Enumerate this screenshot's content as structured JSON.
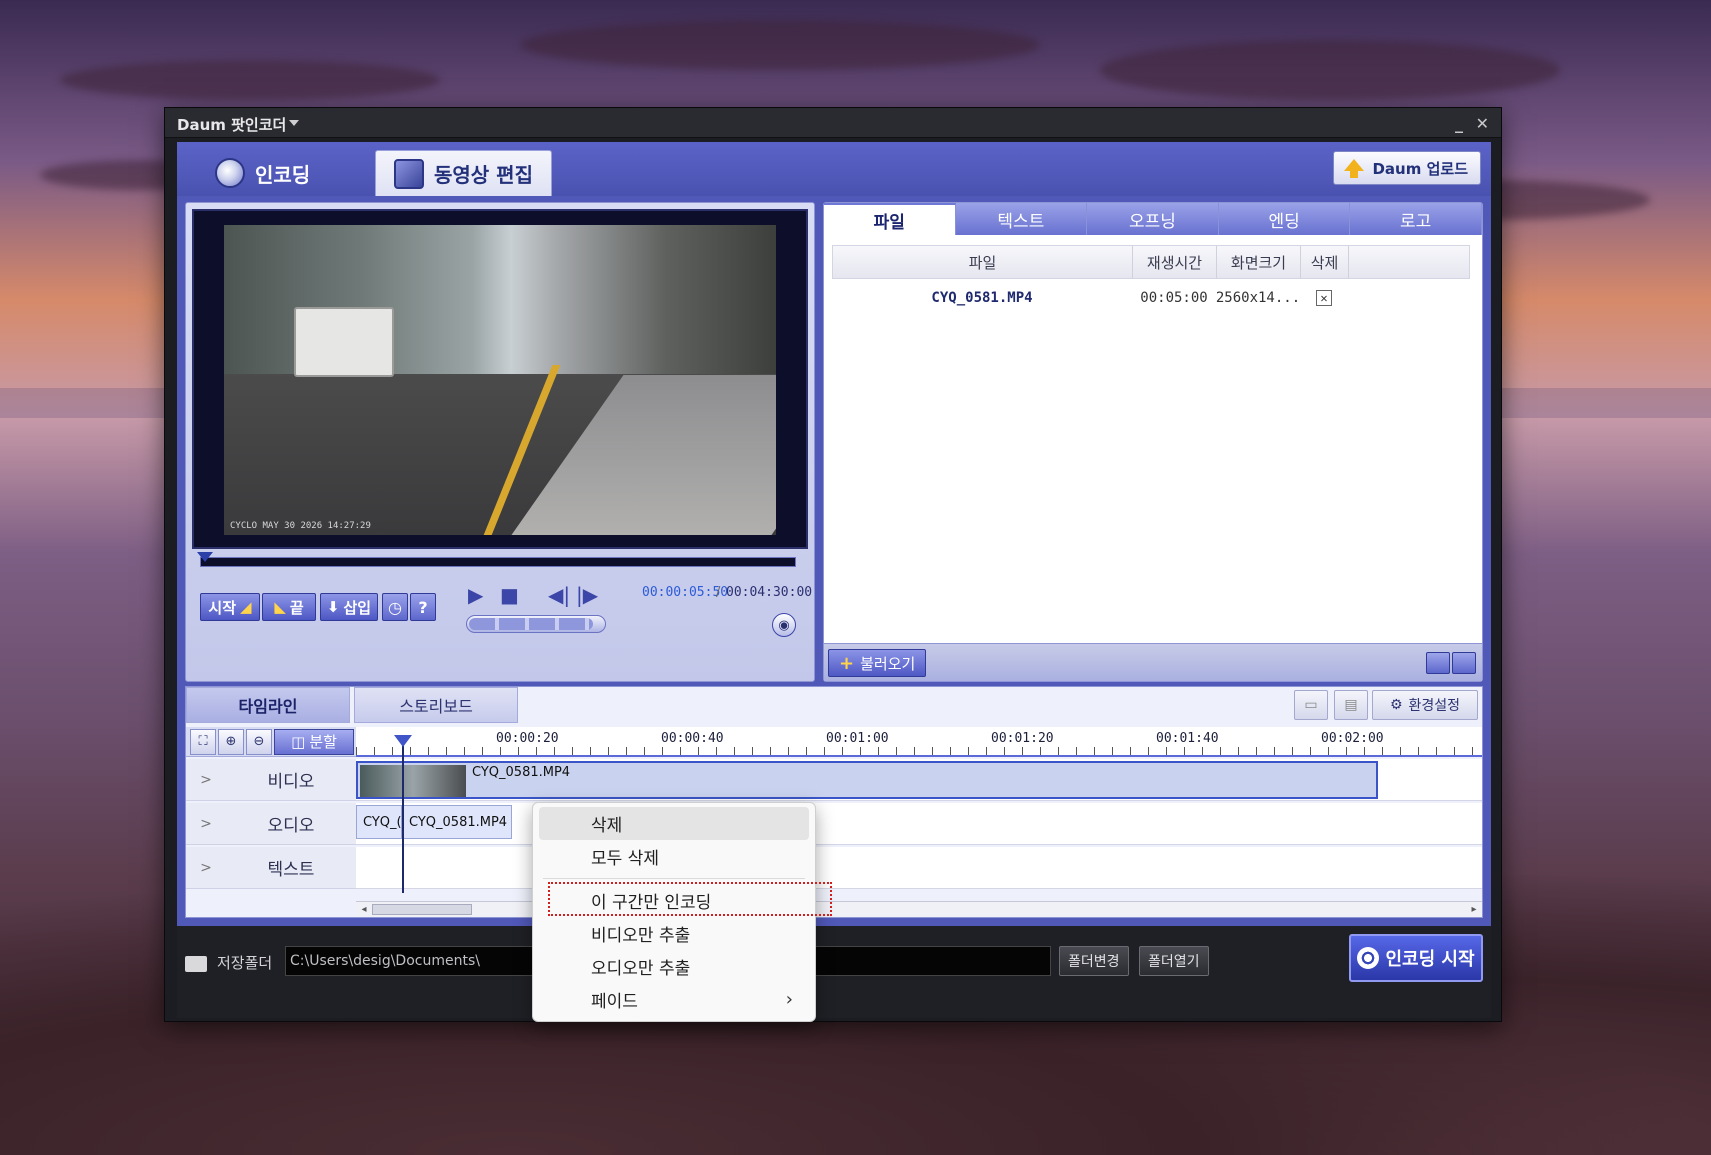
{
  "window": {
    "title": "Daum 팟인코더"
  },
  "main_tabs": [
    {
      "label": "인코딩",
      "icon": "film-reel-icon"
    },
    {
      "label": "동영상 편집",
      "icon": "video-edit-icon"
    }
  ],
  "upload_button": "Daum 업로드",
  "video": {
    "stamp": "CYCLO  MAY 30 2026 14:27:29"
  },
  "player": {
    "start_label": "시작",
    "end_label": "끝",
    "insert_label": "삽입",
    "help_label": "?",
    "time_current": "00:00:05:50",
    "time_separator": "/",
    "time_total": "00:04:30:00",
    "volume_level": 0.93
  },
  "file_panel": {
    "tabs": [
      "파일",
      "텍스트",
      "오프닝",
      "엔딩",
      "로고"
    ],
    "columns": [
      "파일",
      "재생시간",
      "화면크기",
      "삭제"
    ],
    "rows": [
      {
        "file": "CYQ_0581.MP4",
        "duration": "00:05:00",
        "size": "2560x14..."
      }
    ],
    "load_label": "불러오기"
  },
  "timeline": {
    "tabs": [
      "타임라인",
      "스토리보드"
    ],
    "settings_label": "환경설정",
    "split_label": "분할",
    "ruler": [
      "00:00:20",
      "00:00:40",
      "00:01:00",
      "00:01:20",
      "00:01:40",
      "00:02:00"
    ],
    "tracks": [
      "비디오",
      "오디오",
      "텍스트"
    ],
    "video_clip_name": "CYQ_0581.MP4",
    "audio_clip_a": "CYQ_(",
    "audio_clip_b": "CYQ_0581.MP4"
  },
  "savebar": {
    "label": "저장폴더",
    "path": "C:\\Users\\desig\\Documents\\",
    "change_folder": "폴더변경",
    "open_folder": "폴더열기",
    "encode_start": "인코딩 시작"
  },
  "context_menu": {
    "items": [
      "삭제",
      "모두 삭제",
      "이 구간만 인코딩",
      "비디오만 추출",
      "오디오만 추출",
      "페이드"
    ],
    "highlighted": "이 구간만 인코딩",
    "highlight_color": "#d21e1e"
  }
}
